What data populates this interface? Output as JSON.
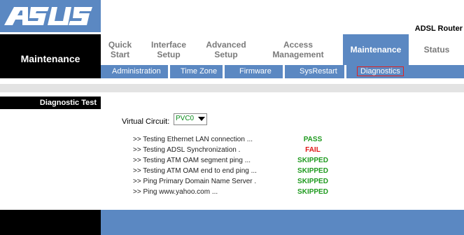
{
  "header": {
    "logo": "ASUS",
    "product_name": "ADSL Router"
  },
  "left": {
    "title": "Maintenance",
    "section": "Diagnostic Test"
  },
  "nav": {
    "tabs": [
      {
        "label": "Quick Start"
      },
      {
        "label": "Interface Setup"
      },
      {
        "label": "Advanced Setup"
      },
      {
        "label": "Access Management"
      },
      {
        "label": "Maintenance",
        "active": true
      },
      {
        "label": "Status"
      }
    ],
    "subnav": [
      {
        "label": "Administration"
      },
      {
        "label": "Time Zone"
      },
      {
        "label": "Firmware"
      },
      {
        "label": "SysRestart"
      },
      {
        "label": "Diagnostics",
        "active": true
      }
    ]
  },
  "diagnostics": {
    "vc_label": "Virtual Circuit:",
    "vc_value": "PVC0",
    "tests": [
      {
        "text": ">> Testing Ethernet LAN connection ...",
        "status": "PASS",
        "color": "#1f9a1f"
      },
      {
        "text": ">> Testing ADSL Synchronization .",
        "status": "FAIL",
        "color": "#e01515"
      },
      {
        "text": ">> Testing ATM OAM segment ping ...",
        "status": "SKIPPED",
        "color": "#1f9a1f"
      },
      {
        "text": ">> Testing ATM OAM end to end ping ...",
        "status": "SKIPPED",
        "color": "#1f9a1f"
      },
      {
        "text": ">> Ping Primary Domain Name Server .",
        "status": "SKIPPED",
        "color": "#1f9a1f"
      },
      {
        "text": ">> Ping www.yahoo.com ...",
        "status": "SKIPPED",
        "color": "#1f9a1f"
      }
    ]
  },
  "colors": {
    "nav_blue": "#5b88c2",
    "pass_green": "#1f9a1f",
    "fail_red": "#e01515"
  }
}
